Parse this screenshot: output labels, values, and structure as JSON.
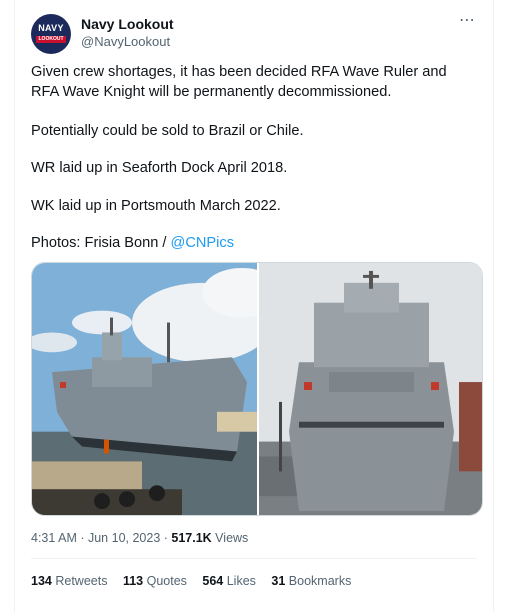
{
  "author": {
    "display_name": "Navy Lookout",
    "handle": "@NavyLookout",
    "avatar_text_top": "NAVY",
    "avatar_text_bottom": "LOOKOUT"
  },
  "more_icon": "⋯",
  "tweet": {
    "paragraph1": "Given crew shortages, it has been decided RFA Wave Ruler and RFA Wave Knight will be permanently decommissioned.",
    "paragraph2": "Potentially could be sold to Brazil or Chile.",
    "paragraph3": "WR laid up in Seaforth Dock  April 2018.",
    "paragraph4": "WK laid up in Portsmouth March 2022.",
    "photos_prefix": "Photos: Frisia Bonn / ",
    "photos_mention": "@CNPics"
  },
  "meta": {
    "time": "4:31 AM",
    "separator": " · ",
    "date": "Jun 10, 2023",
    "views_count": "517.1K",
    "views_label": " Views"
  },
  "stats": {
    "retweets_count": "134",
    "retweets_label": "Retweets",
    "quotes_count": "113",
    "quotes_label": "Quotes",
    "likes_count": "564",
    "likes_label": "Likes",
    "bookmarks_count": "31",
    "bookmarks_label": "Bookmarks"
  },
  "colors": {
    "link": "#1d9bf0",
    "muted": "#536471",
    "text": "#0f1419"
  }
}
